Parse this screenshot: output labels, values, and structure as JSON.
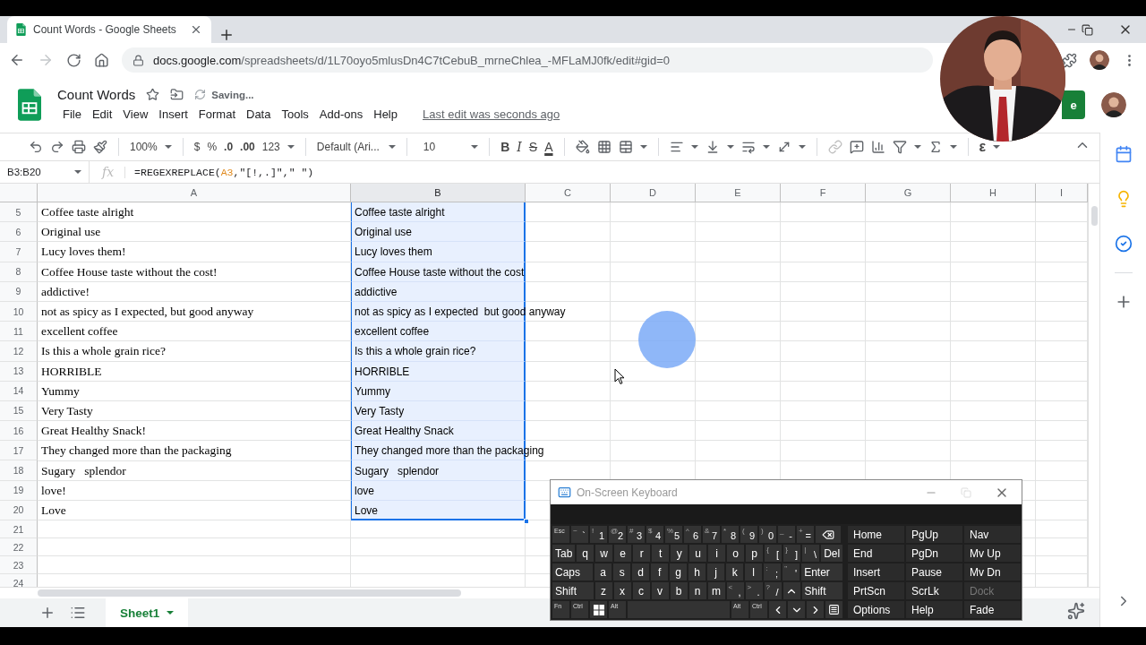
{
  "browser": {
    "tab": {
      "title": "Count Words - Google Sheets"
    },
    "forward_disabled": true,
    "url": {
      "domain": "docs.google.com",
      "path": "/spreadsheets/d/1L70oyo5mlusDn4C7tCebuB_mrneChlea_-MFLaMJ0fk/edit#gid=0"
    }
  },
  "document": {
    "title": "Count Words",
    "status": "Saving...",
    "menu": [
      "File",
      "Edit",
      "View",
      "Insert",
      "Format",
      "Data",
      "Tools",
      "Add-ons",
      "Help"
    ],
    "last_edit": "Last edit was seconds ago",
    "share_label": "e"
  },
  "toolbar": {
    "zoom": "100%",
    "currency": "$",
    "percent": "%",
    "decimal_less": ".0",
    "decimal_more": ".00",
    "number_format": "123",
    "font": "Default (Ari...",
    "font_size": "10",
    "bold": "B",
    "italic": "I",
    "strike": "S",
    "text_color": "A",
    "addon": "ε"
  },
  "formula_bar": {
    "name_box": "B3:B20",
    "function_symbol": "fx",
    "formula": [
      {
        "kind": "plain",
        "text": "=REGEXREPLACE("
      },
      {
        "kind": "reference",
        "text": "A3"
      },
      {
        "kind": "plain",
        "text": ",\"[!,.]\",\" \")"
      }
    ]
  },
  "columns": [
    "A",
    "B",
    "C",
    "D",
    "E",
    "F",
    "G",
    "H",
    "I"
  ],
  "rows": [
    {
      "number": "5",
      "cells": [
        {
          "text": "Coffee taste alright",
          "selected": false
        },
        {
          "text": "Coffee taste alright",
          "selected": true
        }
      ]
    },
    {
      "number": "6",
      "cells": [
        {
          "text": "Original use",
          "selected": false
        },
        {
          "text": "Original use",
          "selected": true
        }
      ]
    },
    {
      "number": "7",
      "cells": [
        {
          "text": "Lucy loves them!",
          "selected": false
        },
        {
          "text": "Lucy loves them",
          "selected": true
        }
      ]
    },
    {
      "number": "8",
      "cells": [
        {
          "text": "Coffee House taste without the cost!",
          "selected": false
        },
        {
          "text": "Coffee House taste without the cost",
          "selected": true
        }
      ]
    },
    {
      "number": "9",
      "cells": [
        {
          "text": "addictive!",
          "selected": false
        },
        {
          "text": "addictive",
          "selected": true
        }
      ]
    },
    {
      "number": "10",
      "cells": [
        {
          "text": "not as spicy as I expected, but good anyway",
          "selected": false
        },
        {
          "text": "not as spicy as I expected  but good anyway",
          "selected": true
        }
      ]
    },
    {
      "number": "11",
      "cells": [
        {
          "text": "excellent coffee",
          "selected": false
        },
        {
          "text": "excellent coffee",
          "selected": true
        }
      ]
    },
    {
      "number": "12",
      "cells": [
        {
          "text": "Is this a whole grain rice?",
          "selected": false
        },
        {
          "text": "Is this a whole grain rice?",
          "selected": true
        }
      ]
    },
    {
      "number": "13",
      "cells": [
        {
          "text": "HORRIBLE",
          "selected": false
        },
        {
          "text": "HORRIBLE",
          "selected": true
        }
      ]
    },
    {
      "number": "14",
      "cells": [
        {
          "text": "Yummy",
          "selected": false
        },
        {
          "text": "Yummy",
          "selected": true
        }
      ]
    },
    {
      "number": "15",
      "cells": [
        {
          "text": "Very Tasty",
          "selected": false
        },
        {
          "text": "Very Tasty",
          "selected": true
        }
      ]
    },
    {
      "number": "16",
      "cells": [
        {
          "text": "Great Healthy Snack!",
          "selected": false
        },
        {
          "text": "Great Healthy Snack",
          "selected": true
        }
      ]
    },
    {
      "number": "17",
      "cells": [
        {
          "text": "They changed more than the packaging",
          "selected": false
        },
        {
          "text": "They changed more than the packaging",
          "selected": true
        }
      ]
    },
    {
      "number": "18",
      "cells": [
        {
          "text": "Sugary   splendor",
          "selected": false
        },
        {
          "text": "Sugary   splendor",
          "selected": true
        }
      ]
    },
    {
      "number": "19",
      "cells": [
        {
          "text": "love!",
          "selected": false
        },
        {
          "text": "love",
          "selected": true
        }
      ]
    },
    {
      "number": "20",
      "cells": [
        {
          "text": "Love",
          "selected": false
        },
        {
          "text": "Love",
          "selected": true
        }
      ]
    },
    {
      "number": "21"
    },
    {
      "number": "22"
    },
    {
      "number": "23"
    },
    {
      "number": "24"
    }
  ],
  "sheet_tabs": [
    {
      "label": "Sheet1",
      "selected": true
    }
  ],
  "keyboard": {
    "title": "On-Screen Keyboard",
    "rows": [
      {
        "keys": [
          {
            "kind": "mini",
            "text": "Esc"
          },
          {
            "kind": "dual",
            "top": "~",
            "text": "`"
          },
          {
            "kind": "dual",
            "top": "!",
            "text": "1"
          },
          {
            "kind": "dual",
            "top": "@",
            "text": "2"
          },
          {
            "kind": "dual",
            "top": "#",
            "text": "3"
          },
          {
            "kind": "dual",
            "top": "$",
            "text": "4"
          },
          {
            "kind": "dual",
            "top": "%",
            "text": "5"
          },
          {
            "kind": "dual",
            "top": "^",
            "text": "6"
          },
          {
            "kind": "dual",
            "top": "&",
            "text": "7"
          },
          {
            "kind": "dual",
            "top": "*",
            "text": "8"
          },
          {
            "kind": "dual",
            "top": "(",
            "text": "9"
          },
          {
            "kind": "dual",
            "top": ")",
            "text": "0"
          },
          {
            "kind": "dual",
            "top": "_",
            "text": "-"
          },
          {
            "kind": "dual",
            "top": "+",
            "text": "="
          },
          {
            "kind": "backspace"
          }
        ]
      },
      {
        "keys": [
          {
            "kind": "label",
            "text": "Tab"
          },
          {
            "kind": "char",
            "text": "q"
          },
          {
            "kind": "char",
            "text": "w"
          },
          {
            "kind": "char",
            "text": "e"
          },
          {
            "kind": "char",
            "text": "r"
          },
          {
            "kind": "char",
            "text": "t"
          },
          {
            "kind": "char",
            "text": "y"
          },
          {
            "kind": "char",
            "text": "u"
          },
          {
            "kind": "char",
            "text": "i"
          },
          {
            "kind": "char",
            "text": "o"
          },
          {
            "kind": "char",
            "text": "p"
          },
          {
            "kind": "dual",
            "top": "{",
            "text": "["
          },
          {
            "kind": "dual",
            "top": "}",
            "text": "]"
          },
          {
            "kind": "dual",
            "top": "|",
            "text": "\\"
          },
          {
            "kind": "label",
            "text": "Del"
          }
        ]
      },
      {
        "keys": [
          {
            "kind": "label",
            "text": "Caps"
          },
          {
            "kind": "char",
            "text": "a"
          },
          {
            "kind": "char",
            "text": "s"
          },
          {
            "kind": "char",
            "text": "d"
          },
          {
            "kind": "char",
            "text": "f"
          },
          {
            "kind": "char",
            "text": "g"
          },
          {
            "kind": "char",
            "text": "h"
          },
          {
            "kind": "char",
            "text": "j"
          },
          {
            "kind": "char",
            "text": "k"
          },
          {
            "kind": "char",
            "text": "l"
          },
          {
            "kind": "dual",
            "top": ":",
            "text": ";"
          },
          {
            "kind": "dual",
            "top": "\"",
            "text": "'"
          },
          {
            "kind": "label",
            "text": "Enter"
          }
        ]
      },
      {
        "keys": [
          {
            "kind": "label",
            "text": "Shift"
          },
          {
            "kind": "char",
            "text": "z"
          },
          {
            "kind": "char",
            "text": "x"
          },
          {
            "kind": "char",
            "text": "c"
          },
          {
            "kind": "char",
            "text": "v"
          },
          {
            "kind": "char",
            "text": "b"
          },
          {
            "kind": "char",
            "text": "n"
          },
          {
            "kind": "char",
            "text": "m"
          },
          {
            "kind": "dual",
            "top": "<",
            "text": ","
          },
          {
            "kind": "dual",
            "top": ">",
            "text": "."
          },
          {
            "kind": "dual",
            "top": "?",
            "text": "/"
          },
          {
            "kind": "up"
          },
          {
            "kind": "label",
            "text": "Shift"
          }
        ]
      },
      {
        "keys": [
          {
            "kind": "mini",
            "text": "Fn"
          },
          {
            "kind": "mini",
            "text": "Ctrl"
          },
          {
            "kind": "windows"
          },
          {
            "kind": "mini",
            "text": "Alt"
          },
          {
            "kind": "space"
          },
          {
            "kind": "mini",
            "text": "Alt"
          },
          {
            "kind": "mini",
            "text": "Ctrl"
          },
          {
            "kind": "left"
          },
          {
            "kind": "down"
          },
          {
            "kind": "right"
          },
          {
            "kind": "menu"
          }
        ]
      }
    ],
    "nav_keys": [
      {
        "text": "Home",
        "disabled": false
      },
      {
        "text": "PgUp",
        "disabled": false
      },
      {
        "text": "Nav",
        "disabled": false
      },
      {
        "text": "End",
        "disabled": false
      },
      {
        "text": "PgDn",
        "disabled": false
      },
      {
        "text": "Mv Up",
        "disabled": false
      },
      {
        "text": "Insert",
        "disabled": false
      },
      {
        "text": "Pause",
        "disabled": false
      },
      {
        "text": "Mv Dn",
        "disabled": false
      },
      {
        "text": "PrtScn",
        "disabled": false
      },
      {
        "text": "ScrLk",
        "disabled": false
      },
      {
        "text": "Dock",
        "disabled": true
      },
      {
        "text": "Options",
        "disabled": false
      },
      {
        "text": "Help",
        "disabled": false
      },
      {
        "text": "Fade",
        "disabled": false
      }
    ]
  }
}
